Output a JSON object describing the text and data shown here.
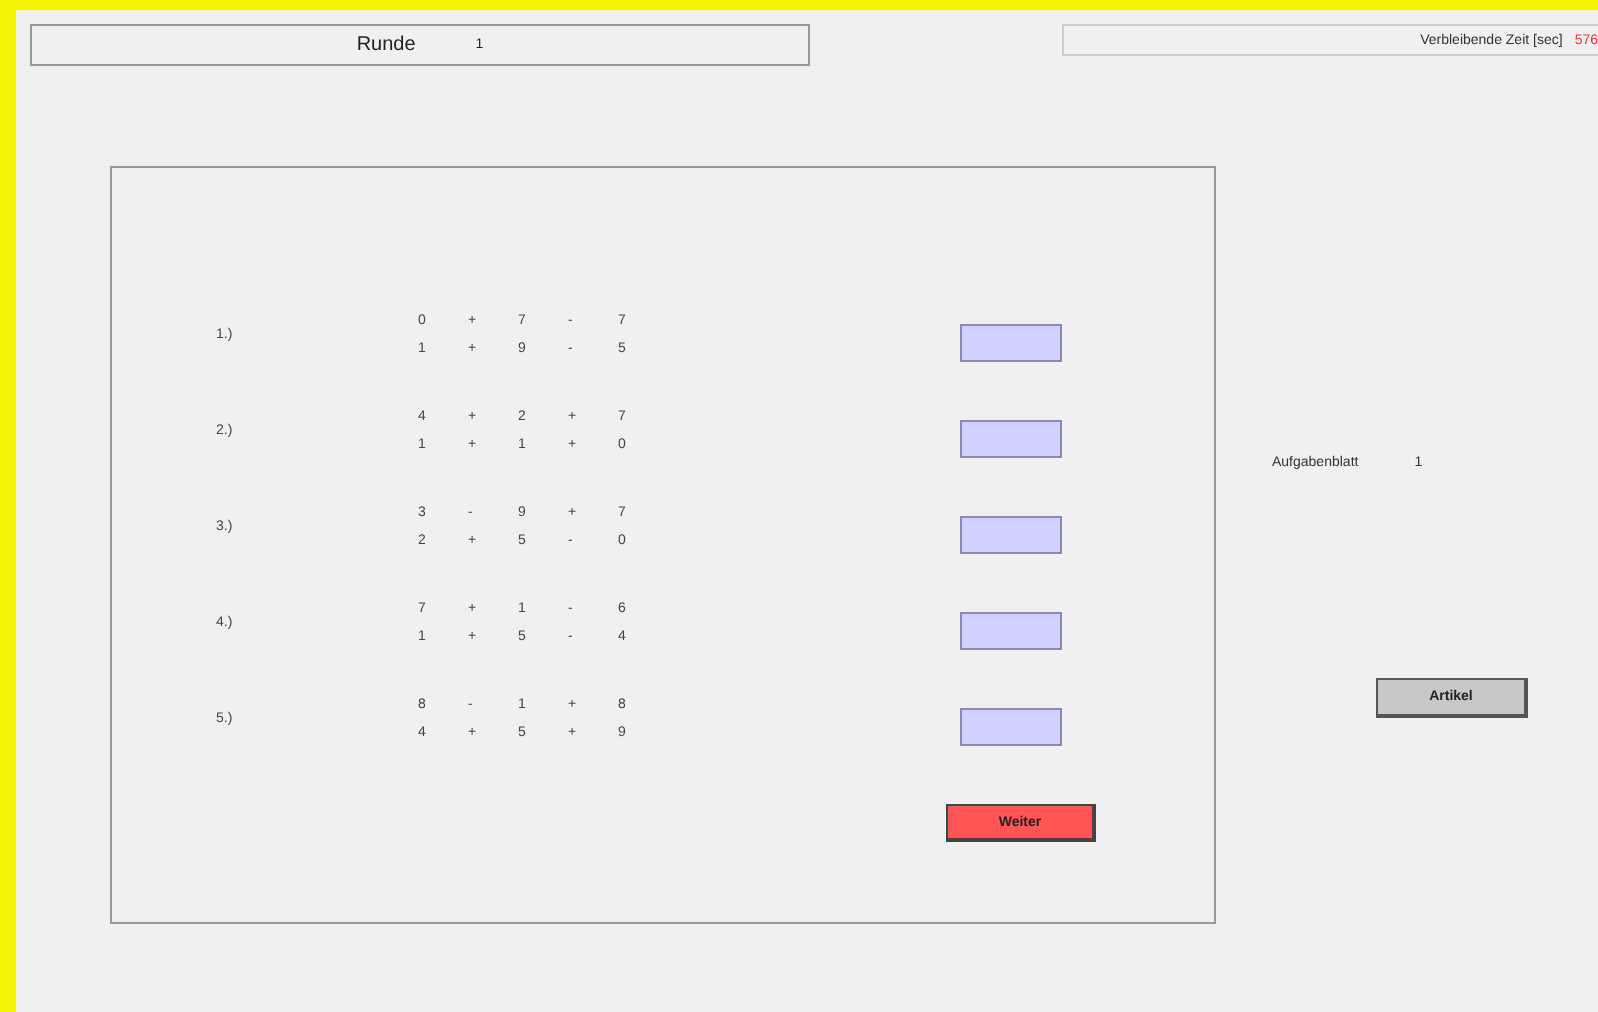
{
  "round": {
    "label": "Runde",
    "value": "1"
  },
  "timer": {
    "label": "Verbleibende Zeit [sec]",
    "value": "576"
  },
  "tasks": [
    {
      "label": "1.)",
      "lines": [
        [
          "0",
          "+",
          "7",
          "-",
          "7"
        ],
        [
          "1",
          "+",
          "9",
          "-",
          "5"
        ]
      ]
    },
    {
      "label": "2.)",
      "lines": [
        [
          "4",
          "+",
          "2",
          "+",
          "7"
        ],
        [
          "1",
          "+",
          "1",
          "+",
          "0"
        ]
      ]
    },
    {
      "label": "3.)",
      "lines": [
        [
          "3",
          "-",
          "9",
          "+",
          "7"
        ],
        [
          "2",
          "+",
          "5",
          "-",
          "0"
        ]
      ]
    },
    {
      "label": "4.)",
      "lines": [
        [
          "7",
          "+",
          "1",
          "-",
          "6"
        ],
        [
          "1",
          "+",
          "5",
          "-",
          "4"
        ]
      ]
    },
    {
      "label": "5.)",
      "lines": [
        [
          "8",
          "-",
          "1",
          "+",
          "8"
        ],
        [
          "4",
          "+",
          "5",
          "+",
          "9"
        ]
      ]
    }
  ],
  "next_button": "Weiter",
  "sheet": {
    "label": "Aufgabenblatt",
    "value": "1"
  },
  "article_button": "Artikel"
}
